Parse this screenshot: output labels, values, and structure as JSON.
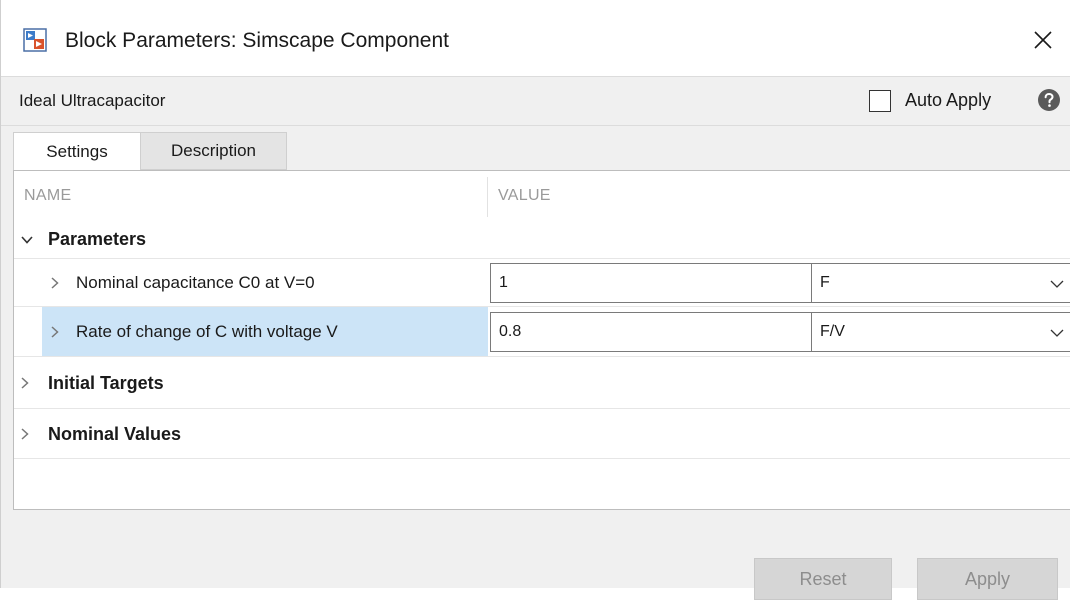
{
  "window": {
    "title": "Block Parameters: Simscape Component"
  },
  "header": {
    "block_name": "Ideal Ultracapacitor",
    "auto_apply_label": "Auto Apply",
    "auto_apply_checked": false
  },
  "tabs": [
    {
      "label": "Settings",
      "active": true
    },
    {
      "label": "Description",
      "active": false
    }
  ],
  "table": {
    "columns": [
      "NAME",
      "VALUE"
    ],
    "groups": [
      {
        "label": "Parameters",
        "expanded": true,
        "params": [
          {
            "name": "Nominal capacitance C0 at V=0",
            "value": "1",
            "unit": "F",
            "selected": false
          },
          {
            "name": "Rate of change of C with voltage V",
            "value": "0.8",
            "unit": "F/V",
            "selected": true
          }
        ]
      },
      {
        "label": "Initial Targets",
        "expanded": false
      },
      {
        "label": "Nominal Values",
        "expanded": false
      }
    ]
  },
  "buttons": {
    "reset": "Reset",
    "apply": "Apply"
  },
  "colors": {
    "selection": "#cce4f7",
    "disabled_button": "#d6d6d6",
    "disabled_text": "#8d8d8d"
  },
  "icons": {
    "title": "simulink-block-icon",
    "close": "close-icon",
    "help": "help-icon"
  }
}
